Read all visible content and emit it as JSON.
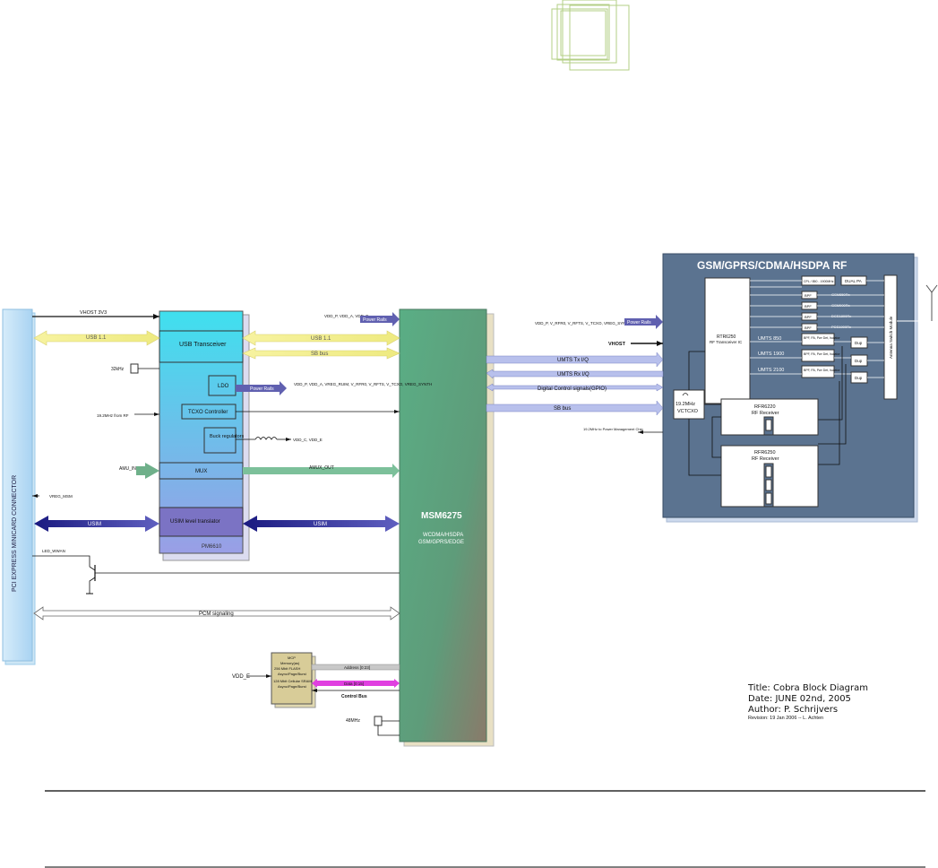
{
  "connector": {
    "label": "PCI EXPRESS MINICARD CONNECTOR"
  },
  "pmic": {
    "name": "PM6610",
    "usb_transceiver": "USB Transceiver",
    "ldo": "LDO",
    "tcxo": "TCXO Controller",
    "buck": "Buck regulators",
    "mux": "MUX",
    "usim_translator": "USIM level translator"
  },
  "msm": {
    "name": "MSM6275",
    "sub1": "WCDMA/HSDPA",
    "sub2": "GSM/GPRS/EDGE"
  },
  "rf": {
    "title": "GSM/GPRS/CDMA/HSDPA RF",
    "transceiver": "RTR6250",
    "transceiver_sub": "RF Transceiver IC",
    "pa_gsm": "DUAL PA",
    "coupler": "CPL / 850 - 1900MHz",
    "switch": "Antenna Switch Module",
    "bpf": "BPF",
    "gsm_rx": [
      "GSM850Rx",
      "GSM900Rx",
      "DCS1800Rx",
      "PCS1900Rx"
    ],
    "umts_bands": [
      "UMTS 850",
      "UMTS 1900",
      "UMTS 2100"
    ],
    "pa_block": "BPF, PA, Pwr Det, Isolator",
    "dup": "Dup",
    "vctcxo_freq": "19.2MHz",
    "vctcxo": "VCTCXO",
    "rfr1_name": "RFR6220",
    "rfr1_sub": "RF Receiver",
    "rfr2_name": "RFR6250",
    "rfr2_sub": "RF Receiver",
    "clk_to_pm": "19.2MHz to Power Management Chip"
  },
  "signals": {
    "vhost": "VHOST 3V3",
    "usb_left": "USB 1.1",
    "usb_mid": "USB 1.1",
    "sb_bus": "SB bus",
    "khz": "32kHz",
    "vdd_top": "VDD_P, VDD_A, VDD_E",
    "power_rails": "Power Rails",
    "ldo_rails": "VDD_P, VDD_A, VREG_RUIM, V_RFR0, V_RFTS, V_TCXO, VREG_SYNTH",
    "tcxo_in": "19.2MHz from RF",
    "vdd_buck": "VDD_C, VDD_E",
    "amu_in": "AMU_IN",
    "amux_out": "AMUX_OUT",
    "vreg_msm": "VREG_MSM",
    "usim_left": "USIM",
    "usim_mid": "USIM",
    "led": "LED_WWAN",
    "pcm": "PCM signaling",
    "vdd_rf": "VDD_P, V_RFR0, V_RFTS, V_TCXO, VREG_SYNTH",
    "power_rails_rf": "Power Rails",
    "vhost_rf": "VHOST",
    "umts_tx": "UMTS Tx I/Q",
    "umts_rx": "UMTS Rx I/Q",
    "gpio": "Digital Control signals(GPIO)",
    "sbi": "SB bus",
    "vdd_e": "VDD_E",
    "addr": "Address [0:23]",
    "data": "Data [0:15]",
    "control_bus": "Control Bus",
    "mhz48": "48MHz"
  },
  "memory": {
    "line1": "MCP",
    "line2": "Memory(as)",
    "line3": "256 Mbit FLASH",
    "line4": "Async/Page/Burst",
    "line5": "128 Mbit Cellular SRAM",
    "line6": "Async/Page/Burst"
  },
  "title_block": {
    "title": "Title: Cobra Block Diagram",
    "date": "Date: JUNE 02nd, 2005",
    "author": "Author: P. Schrijvers",
    "revision": "Revision: 19 Jan 2006 -- L. Achten"
  }
}
